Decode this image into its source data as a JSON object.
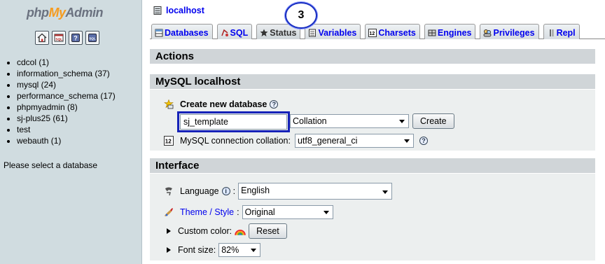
{
  "nav": {
    "logo": {
      "php": "php",
      "my": "My",
      "admin": "Admin"
    },
    "quick_icons": [
      "home-icon",
      "sql-query-icon",
      "help-icon",
      "sql-docs-icon"
    ],
    "databases": [
      "cdcol (1)",
      "information_schema (37)",
      "mysql (24)",
      "performance_schema (17)",
      "phpmyadmin (8)",
      "sj-plus25 (61)",
      "test",
      "webauth (1)"
    ],
    "hint": "Please select a database"
  },
  "header": {
    "server_label": "localhost",
    "step_badge": "3"
  },
  "tabs": [
    {
      "name": "databases",
      "label": "Databases",
      "icon": "databases-icon"
    },
    {
      "name": "sql",
      "label": "SQL",
      "icon": "sql-icon"
    },
    {
      "name": "status",
      "label": "Status",
      "icon": "status-icon"
    },
    {
      "name": "variables",
      "label": "Variables",
      "icon": "variables-icon"
    },
    {
      "name": "charsets",
      "label": "Charsets",
      "icon": "charsets-icon"
    },
    {
      "name": "engines",
      "label": "Engines",
      "icon": "engines-icon"
    },
    {
      "name": "privileges",
      "label": "Privileges",
      "icon": "privileges-icon"
    },
    {
      "name": "replication",
      "label": "Repl",
      "icon": "replication-icon"
    }
  ],
  "actions": {
    "title": "Actions"
  },
  "mysql_section": {
    "title": "MySQL localhost",
    "create_db_label": "Create new database",
    "db_name_value": "sj_template",
    "collation_placeholder": "Collation",
    "create_button": "Create",
    "connection_collation_label": "MySQL connection collation:",
    "connection_collation_value": "utf8_general_ci"
  },
  "interface": {
    "title": "Interface",
    "language_label": "Language",
    "language_value": "English",
    "theme_label": "Theme / Style",
    "theme_colon": ":",
    "theme_value": "Original",
    "custom_color_label": "Custom color:",
    "reset_button": "Reset",
    "font_size_label": "Font size:",
    "font_size_value": "82%"
  },
  "colors": {
    "nav_bg": "#d0dce0",
    "link": "#0000ee",
    "highlight": "#1622b8",
    "section_head": "#d0d5d8",
    "section_body": "#ecefef"
  }
}
